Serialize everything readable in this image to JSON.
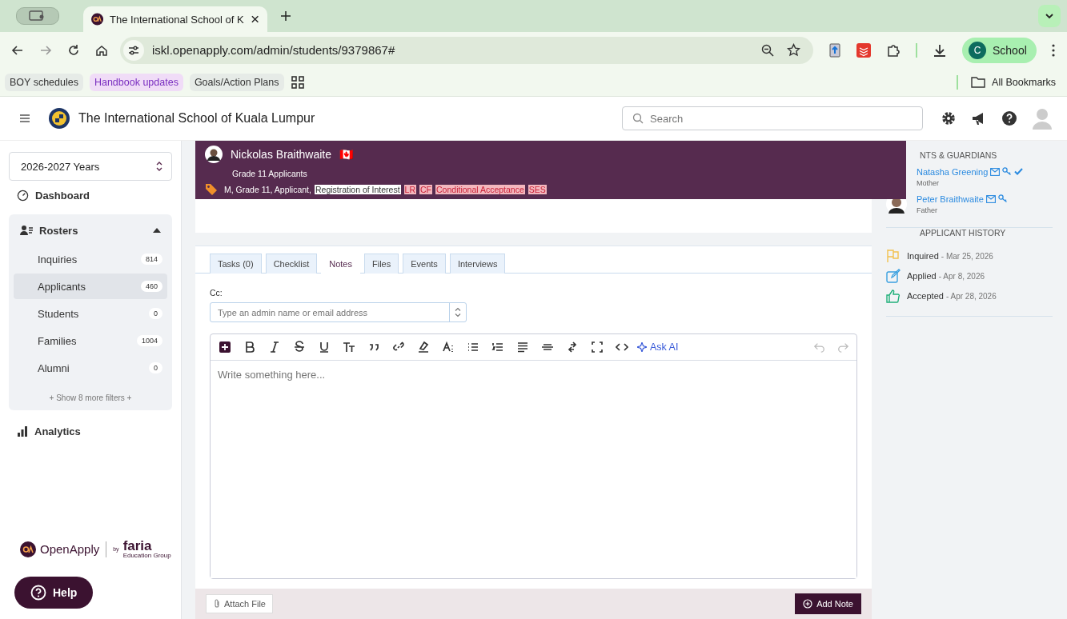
{
  "browser": {
    "tab_title": "The International School of K",
    "url": "iskl.openapply.com/admin/students/9379867#",
    "profile": {
      "initial": "C",
      "name": "School"
    },
    "bookmarks": [
      {
        "label": "BOY schedules",
        "selected": false
      },
      {
        "label": "Handbook updates",
        "selected": true
      },
      {
        "label": "Goals/Action Plans",
        "selected": false
      }
    ],
    "all_bookmarks": "All Bookmarks"
  },
  "header": {
    "school_name": "The International School of Kuala Lumpur",
    "search": {
      "placeholder": "Search"
    }
  },
  "sidebar": {
    "year": "2026-2027 Years",
    "dashboard": "Dashboard",
    "rosters": {
      "label": "Rosters",
      "expanded": true,
      "items": [
        {
          "label": "Inquiries",
          "count": "814",
          "selected": false
        },
        {
          "label": "Applicants",
          "count": "460",
          "selected": true
        },
        {
          "label": "Students",
          "count": "0",
          "selected": false
        },
        {
          "label": "Families",
          "count": "1004",
          "selected": false
        },
        {
          "label": "Alumni",
          "count": "0",
          "selected": false
        }
      ],
      "more_filters": "+ Show 8 more filters +"
    },
    "analytics": "Analytics",
    "brand": {
      "name": "OpenApply",
      "by": "by",
      "maker": "faria",
      "maker_sub": "Education Group"
    },
    "help": "Help"
  },
  "student": {
    "name": "Nickolas Braithwaite",
    "flag": "🇨🇦",
    "group": "Grade 11 Applicants",
    "summary": "M, Grade 11, Applicant,",
    "tags": [
      {
        "label": "Registration of Interest",
        "kind": "plain"
      },
      {
        "label": "LR",
        "kind": "alert"
      },
      {
        "label": "CF",
        "kind": "alert"
      },
      {
        "label": "Conditional Acceptance",
        "kind": "alert"
      },
      {
        "label": "SES",
        "kind": "alert"
      }
    ]
  },
  "tabs": [
    {
      "label": "Tasks (0)",
      "selected": false
    },
    {
      "label": "Checklist",
      "selected": false
    },
    {
      "label": "Notes",
      "selected": true
    },
    {
      "label": "Files",
      "selected": false
    },
    {
      "label": "Events",
      "selected": false
    },
    {
      "label": "Interviews",
      "selected": false
    }
  ],
  "note_form": {
    "cc_label": "Cc:",
    "cc_placeholder": "Type an admin name or email address",
    "ask_ai": "Ask AI",
    "editor_placeholder": "Write something here...",
    "attach": "Attach File",
    "submit": "Add Note"
  },
  "guardians": {
    "heading": "NTS & GUARDIANS",
    "items": [
      {
        "name": "Natasha Greening",
        "relation": "Mother",
        "verified": true,
        "avatar": false
      },
      {
        "name": "Peter Braithwaite",
        "relation": "Father",
        "verified": false,
        "avatar": true
      }
    ]
  },
  "history": {
    "heading": "APPLICANT HISTORY",
    "items": [
      {
        "kind": "inquired",
        "label": "Inquired",
        "date": "- Mar 25, 2026"
      },
      {
        "kind": "applied",
        "label": "Applied",
        "date": "- Apr 8, 2026"
      },
      {
        "kind": "accepted",
        "label": "Accepted",
        "date": "- Apr 28, 2026"
      }
    ]
  }
}
